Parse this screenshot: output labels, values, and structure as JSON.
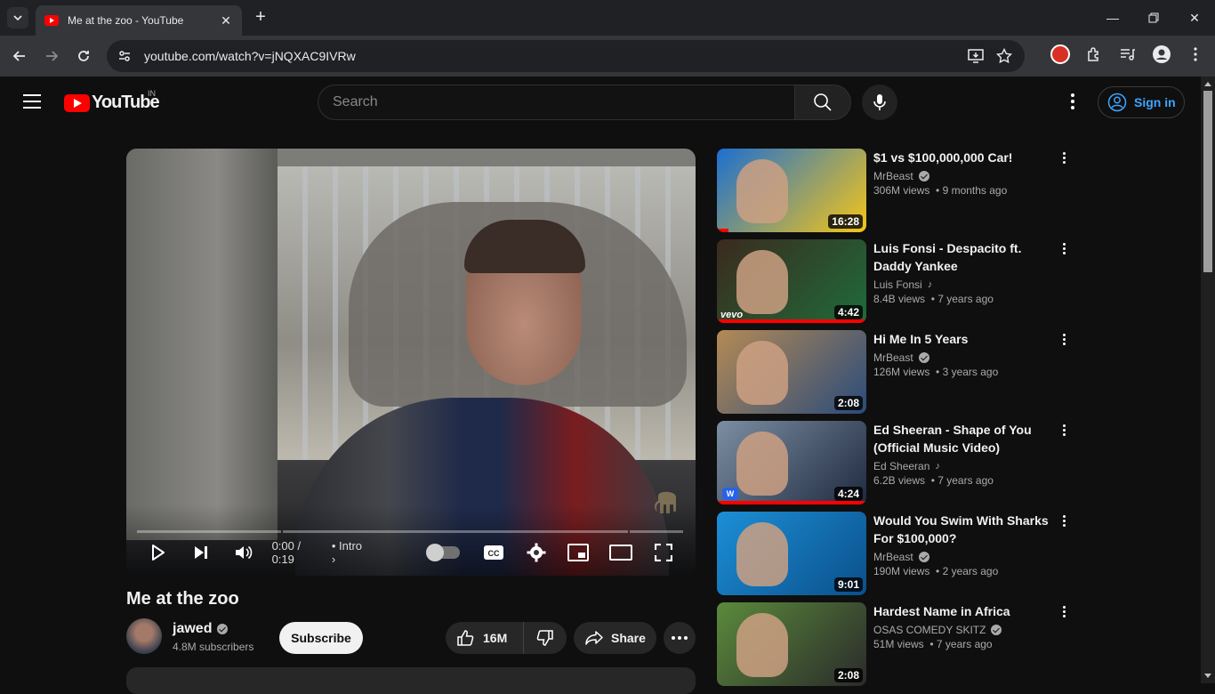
{
  "browser": {
    "tab_title": "Me at the zoo - YouTube",
    "url": "youtube.com/watch?v=jNQXAC9IVRw"
  },
  "masthead": {
    "logo_text": "YouTube",
    "country": "IN",
    "search_placeholder": "Search",
    "signin_label": "Sign in"
  },
  "player": {
    "time": "0:00 / 0:19",
    "chapter": "Intro",
    "progress_fraction": 0
  },
  "video": {
    "title": "Me at the zoo",
    "channel": "jawed",
    "subscribers": "4.8M subscribers",
    "subscribe_label": "Subscribe",
    "likes": "16M",
    "share_label": "Share"
  },
  "recommendations": [
    {
      "title": "$1 vs $100,000,000 Car!",
      "channel": "MrBeast",
      "badge": "verified",
      "views": "306M views",
      "age": "9 months ago",
      "duration": "16:28",
      "colors": [
        "#1c6fd1",
        "#f5c518"
      ],
      "watched": 0.08
    },
    {
      "title": "Luis Fonsi - Despacito ft. Daddy Yankee",
      "channel": "Luis Fonsi",
      "badge": "music",
      "views": "8.4B views",
      "age": "7 years ago",
      "duration": "4:42",
      "colors": [
        "#3b2a1e",
        "#1f6b3a"
      ],
      "watched": 1.0,
      "vevo": "vevo"
    },
    {
      "title": "Hi Me In 5 Years",
      "channel": "MrBeast",
      "badge": "verified",
      "views": "126M views",
      "age": "3 years ago",
      "duration": "2:08",
      "colors": [
        "#b48a55",
        "#2a4b7a"
      ],
      "watched": 0
    },
    {
      "title": "Ed Sheeran - Shape of You (Official Music Video)",
      "channel": "Ed Sheeran",
      "badge": "music",
      "views": "6.2B views",
      "age": "7 years ago",
      "duration": "4:24",
      "colors": [
        "#7c8ea3",
        "#1f2a40"
      ],
      "watched": 1.0,
      "wm": "W"
    },
    {
      "title": "Would You Swim With Sharks For $100,000?",
      "channel": "MrBeast",
      "badge": "verified",
      "views": "190M views",
      "age": "2 years ago",
      "duration": "9:01",
      "colors": [
        "#1c8fd6",
        "#0b4f8a"
      ],
      "watched": 0
    },
    {
      "title": "Hardest Name in Africa",
      "channel": "OSAS COMEDY SKITZ",
      "badge": "verified",
      "views": "51M views",
      "age": "7 years ago",
      "duration": "2:08",
      "colors": [
        "#5b8a3c",
        "#2a2a2a"
      ],
      "watched": 0
    }
  ]
}
